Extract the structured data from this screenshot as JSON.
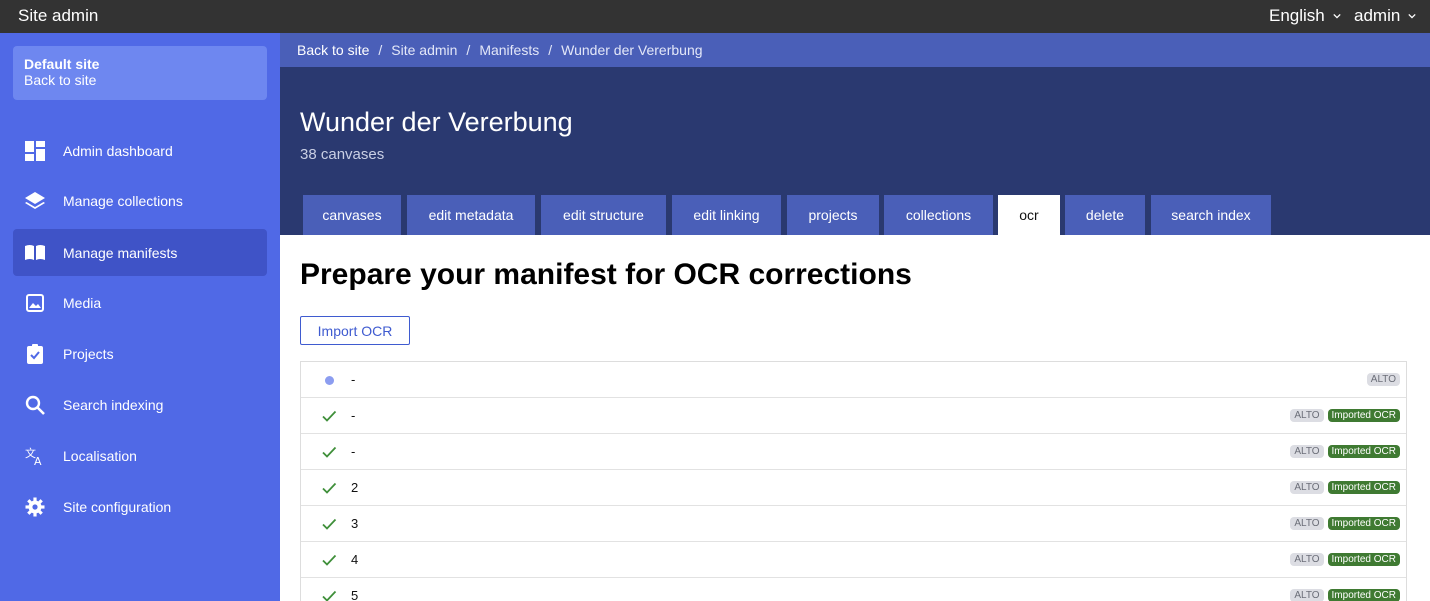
{
  "topbar": {
    "title": "Site admin",
    "language": "English",
    "user": "admin"
  },
  "site_card": {
    "name": "Default site",
    "back_label": "Back to site"
  },
  "sidebar": {
    "items": [
      {
        "label": "Admin dashboard",
        "icon": "dashboard-icon"
      },
      {
        "label": "Manage collections",
        "icon": "layers-icon"
      },
      {
        "label": "Manage manifests",
        "icon": "book-icon",
        "active": true
      },
      {
        "label": "Media",
        "icon": "image-icon"
      },
      {
        "label": "Projects",
        "icon": "clipboard-check-icon"
      },
      {
        "label": "Search indexing",
        "icon": "search-icon"
      },
      {
        "label": "Localisation",
        "icon": "translate-icon"
      },
      {
        "label": "Site configuration",
        "icon": "gear-icon"
      }
    ]
  },
  "breadcrumb": {
    "items": [
      "Back to site",
      "Site admin",
      "Manifests"
    ],
    "current": "Wunder der Vererbung",
    "separator": "/"
  },
  "header": {
    "title": "Wunder der Vererbung",
    "subtitle": "38 canvases"
  },
  "tabs": [
    {
      "label": "canvases"
    },
    {
      "label": "edit metadata"
    },
    {
      "label": "edit structure"
    },
    {
      "label": "edit linking"
    },
    {
      "label": "projects"
    },
    {
      "label": "collections"
    },
    {
      "label": "ocr",
      "active": true
    },
    {
      "label": "delete"
    },
    {
      "label": "search index"
    }
  ],
  "main": {
    "title": "Prepare your manifest for OCR corrections",
    "import_button": "Import OCR"
  },
  "canvas_list": [
    {
      "label": "-",
      "status": "pending",
      "badges": [
        "ALTO"
      ]
    },
    {
      "label": "-",
      "status": "done",
      "badges": [
        "ALTO",
        "Imported OCR"
      ]
    },
    {
      "label": "-",
      "status": "done",
      "badges": [
        "ALTO",
        "Imported OCR"
      ]
    },
    {
      "label": "2",
      "status": "done",
      "badges": [
        "ALTO",
        "Imported OCR"
      ]
    },
    {
      "label": "3",
      "status": "done",
      "badges": [
        "ALTO",
        "Imported OCR"
      ]
    },
    {
      "label": "4",
      "status": "done",
      "badges": [
        "ALTO",
        "Imported OCR"
      ]
    },
    {
      "label": "5",
      "status": "done",
      "badges": [
        "ALTO",
        "Imported OCR"
      ]
    }
  ],
  "colors": {
    "sidebar": "#5069e6",
    "hero": "#2a3970",
    "tab": "#4a5fb8",
    "check": "#3f8f3a",
    "imported_badge": "#3f7a32"
  }
}
